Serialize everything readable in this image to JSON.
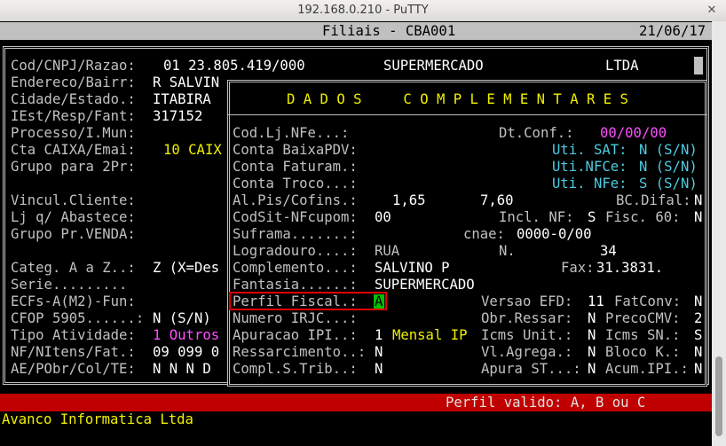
{
  "window": {
    "title": "192.168.0.210 - PuTTY"
  },
  "header": {
    "title": "Filiais - CBA001",
    "date": "21/06/17"
  },
  "popup": {
    "title": "D A D O S     C O M P L E M E N T A R E S"
  },
  "left": {
    "r1_label": "Cod/CNPJ/Razao:",
    "r1_value": "01 23.805.419/000",
    "r1_name": "SUPERMERCADO",
    "r1_type": "LTDA",
    "r2_label": "Endereco/Bairr:",
    "r2_value": "R SALVIN",
    "r3_label": "Cidade/Estado.:",
    "r3_value": "ITABIRA",
    "r4_label": "IEst/Resp/Fant:",
    "r4_value": "317152",
    "r5_label": "Processo/I.Mun:",
    "r6_label": "Cta CAIXA/Emai:",
    "r6_value": "10 CAIX",
    "r7_label": "Grupo para 2Pr:",
    "r8_label": "Vincul.Cliente:",
    "r9_label": "Lj q/ Abastece:",
    "r10_label": "Grupo Pr.VENDA:",
    "r11_label": "Categ. A a Z..:",
    "r11_value": "Z (X=Des",
    "r12_label": "Serie.........",
    "r13_label": "ECFs-A(M2)-Fun:",
    "r14_label": "CFOP 5905......:",
    "r14_value": "N (S/N)",
    "r15_label": "Tipo Atividade:",
    "r15_value": "1 Outros",
    "r16_label": "NF/NItens/Fat.:",
    "r16_value": "09 099 0",
    "r17_label": "AE/PObr/Col/TE:",
    "r17_value": "N N N D"
  },
  "right": {
    "codlj_label": "Cod.Lj.NFe...:",
    "dtconf_label": "Dt.Conf.:",
    "dtconf_value": "00/00/00",
    "baixa_label": "Conta BaixaPDV:",
    "sat_label": "Uti. SAT:",
    "sat_value": "N (S/N)",
    "fatur_label": "Conta Faturam.:",
    "nfce_label": "Uti.NFCe:",
    "nfce_value": "N (S/N)",
    "troco_label": "Conta Troco...:",
    "nfe_label": "Uti. NFe:",
    "nfe_value": "S (S/N)",
    "pis_label": "Al.Pis/Cofins.:",
    "pis_value": "1,65",
    "cofins_value": "7,60",
    "difal_label": "BC.Difal:",
    "difal_value": "N",
    "codsit_label": "CodSit-NFcupom:",
    "codsit_value": "00",
    "inclnf_label": "Incl. NF:",
    "inclnf_value": "S",
    "fisc_label": "Fisc. 60:",
    "fisc_value": "N",
    "sufr_label": "Suframa.......:",
    "cnae_label": "cnae:",
    "cnae_value": "0000-0/00",
    "logr_label": "Logradouro....:",
    "logr_value": "RUA",
    "num_label": "N.",
    "num_value": "34",
    "compl_label": "Complemento...:",
    "compl_value": "SALVINO P",
    "fax_label": "Fax:",
    "fax_value": "31.3831.",
    "fant_label": "Fantasia......:",
    "fant_value": "SUPERMERCADO",
    "perfil_label": "Perfil Fiscal.:",
    "perfil_value": "A",
    "efd_label": "Versao EFD:",
    "efd_value": "11",
    "fatconv_label": "FatConv:",
    "fatconv_value": "N",
    "irjc_label": "Numero IRJC...:",
    "obr_label": "Obr.Ressar:",
    "obr_value": "N",
    "preco_label": "PrecoCMV:",
    "preco_value": "2",
    "ipi_label": "Apuracao IPI..:",
    "ipi_value": "1",
    "ipi_desc": "Mensal IP",
    "icmsu_label": "Icms Unit.:",
    "icmsu_value": "N",
    "icmssn_label": "Icms SN.:",
    "icmssn_value": "S",
    "ress_label": "Ressarcimento..:",
    "ress_value": "N",
    "vlagr_label": "Vl.Agrega.:",
    "vlagr_value": "N",
    "bloco_label": "Bloco K.:",
    "bloco_value": "N",
    "compls_label": "Compl.S.Trib..:",
    "compls_value": "N",
    "apura_label": "Apura ST...:",
    "apura_value": "N",
    "acum_label": "Acum.IPI.:",
    "acum_value": "N"
  },
  "status": {
    "message": "Perfil valido: A, B ou C",
    "company": "Avanco Informatica Ltda"
  }
}
